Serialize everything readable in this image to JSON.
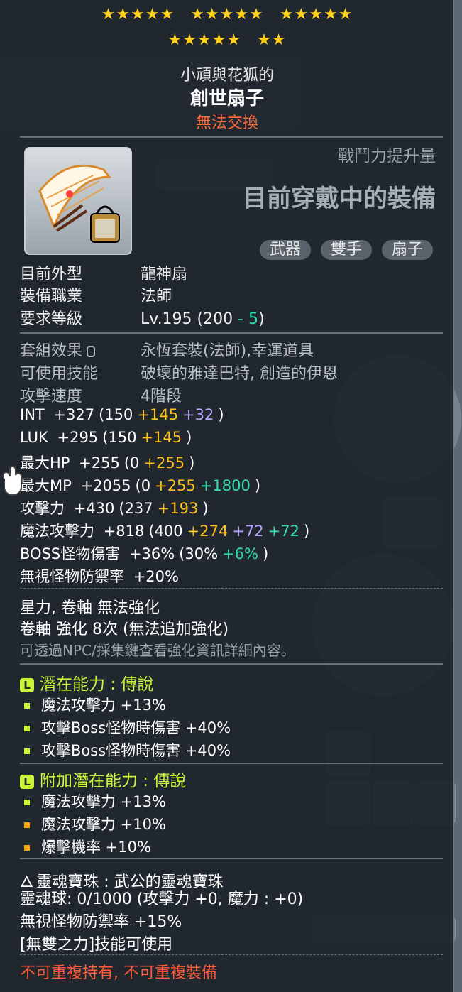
{
  "stars": {
    "row1": [
      "★★★★★",
      "★★★★★",
      "★★★★★"
    ],
    "row2": [
      "★★★★★",
      "★★"
    ]
  },
  "item": {
    "owner": "小頑與花狐的",
    "name": "創世扇子",
    "trade": "無法交換"
  },
  "header": {
    "combat_power": "戰鬥力提升量",
    "wearing": "目前穿戴中的裝備"
  },
  "tags": [
    "武器",
    "雙手",
    "扇子"
  ],
  "basic": [
    {
      "label": "目前外型",
      "value": "龍神扇"
    },
    {
      "label": "裝備職業",
      "value": "法師"
    },
    {
      "label": "要求等級",
      "value": "Lv.195 (200 ",
      "value2": "- 5",
      "value3": ")"
    }
  ],
  "info": [
    {
      "label": "套組效果",
      "value": "永恆套裝(法師),幸運道具"
    },
    {
      "label": "可使用技能",
      "value": "破壞的雅達巴特, 創造的伊恩"
    },
    {
      "label": "攻擊速度",
      "value": "4階段"
    }
  ],
  "stats": [
    {
      "name": "INT",
      "total": "+327",
      "base": "(150",
      "add": "+145",
      "extra": "+32",
      "extra_color": "p",
      "end": ")"
    },
    {
      "name": "LUK",
      "total": "+295",
      "base": "(150",
      "add": "+145",
      "extra": "",
      "extra_color": "p",
      "end": ")"
    },
    {
      "name": "最大HP",
      "total": "+255",
      "base": "(0",
      "add": "+255",
      "extra": "",
      "extra_color": "p",
      "end": ")"
    },
    {
      "name": "最大MP",
      "total": "+2055",
      "base": "(0",
      "add": "+255",
      "extra": "+1800",
      "extra_color": "g",
      "end": ")"
    },
    {
      "name": "攻擊力",
      "total": "+430",
      "base": "(237",
      "add": "+193",
      "extra": "",
      "extra_color": "p",
      "end": ")"
    },
    {
      "name": "魔法攻擊力",
      "total": "+818",
      "base": "(400",
      "add": "+274",
      "extra": "+72",
      "extra_color": "p",
      "extra2": "+72",
      "end": ")"
    },
    {
      "name": "BOSS怪物傷害",
      "total": "+36%",
      "base": "(30%",
      "add": "",
      "extra": "+6%",
      "extra_color": "g",
      "end": ")"
    },
    {
      "name": "無視怪物防禦率",
      "total": "+20%",
      "base": "",
      "add": "",
      "extra": "",
      "extra_color": "p",
      "end": ""
    }
  ],
  "upgrade": {
    "line1": "星力, 卷軸 無法強化",
    "line2": "卷軸 強化 8次 (無法追加強化)",
    "note": "可透過NPC/採集鍵查看強化資訊詳細內容。"
  },
  "potential": {
    "badge": "L",
    "title": "潛在能力 : 傳說",
    "lines": [
      "魔法攻擊力 +13%",
      "攻擊Boss怪物時傷害 +40%",
      "攻擊Boss怪物時傷害 +40%"
    ]
  },
  "bonus_potential": {
    "badge": "L",
    "title": "附加潛在能力 : 傳說",
    "lines": [
      "魔法攻擊力 +13%",
      "魔法攻擊力 +10%",
      "爆擊機率 +10%"
    ]
  },
  "soul": {
    "title": "靈魂寶珠 : 武公的靈魂寶珠",
    "line1": "靈魂球: 0/1000 (攻擊力 +0, 魔力 : +0)",
    "line2": "無視怪物防禦率 +15%",
    "line3": "[無雙之力]技能可使用"
  },
  "footer": {
    "warning": "不可重複持有, 不可重複裝備"
  },
  "colors": {
    "star": "#ffd21a",
    "trade": "#ff6a3a",
    "potential": "#c9f43a",
    "bonus_add": "#ffc21a",
    "bonus_purple": "#b6a6ff",
    "bonus_green": "#33e0b0"
  },
  "icons": {
    "item": "fan-weapon-icon",
    "lock": "lock-icon",
    "cursor": "glove-cursor-icon",
    "soul": "flame-icon"
  }
}
